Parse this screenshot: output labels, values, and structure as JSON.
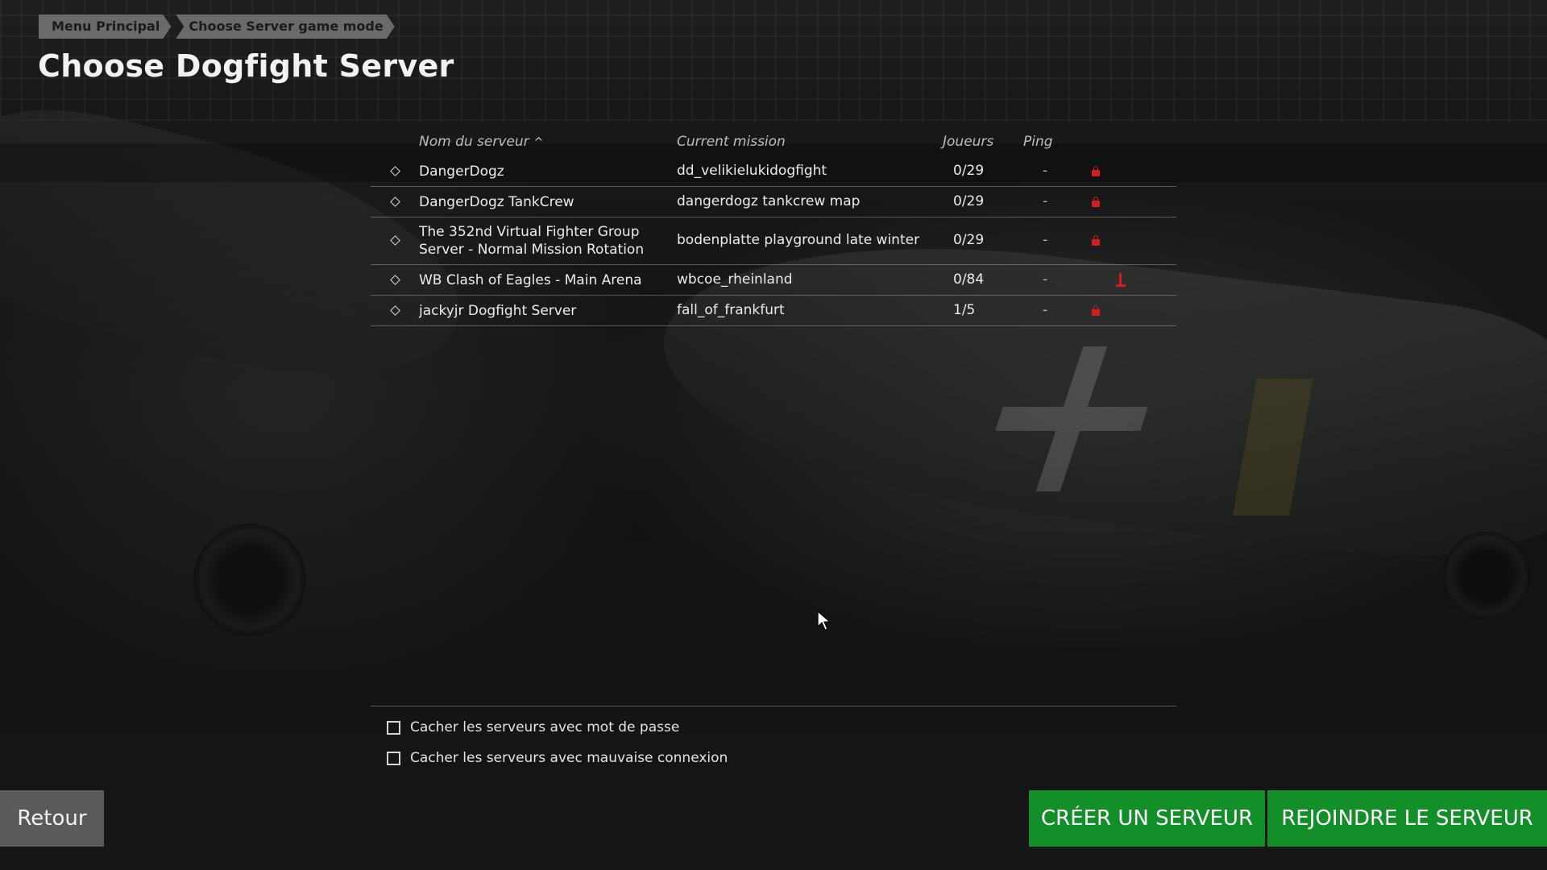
{
  "breadcrumb": {
    "items": [
      "Menu Principal",
      "Choose Server game mode"
    ]
  },
  "page_title": "Choose Dogfight Server",
  "table": {
    "headers": {
      "name": "Nom du serveur",
      "mission": "Current mission",
      "players": "Joueurs",
      "ping": "Ping"
    },
    "sort": {
      "column": "name",
      "direction": "ascending",
      "icon": "chevron-up-icon"
    },
    "rows": [
      {
        "name": "DangerDogz",
        "mission": "dd_velikielukidogfight",
        "players": "0/29",
        "ping": "-",
        "status_icon": "lock-icon"
      },
      {
        "name": "DangerDogz TankCrew",
        "mission": "dangerdogz tankcrew map",
        "players": "0/29",
        "ping": "-",
        "status_icon": "lock-icon"
      },
      {
        "name": "The 352nd Virtual Fighter Group Server - Normal Mission Rotation",
        "mission": "bodenplatte playground late winter",
        "players": "0/29",
        "ping": "-",
        "status_icon": "lock-icon"
      },
      {
        "name": "WB Clash of Eagles - Main Arena",
        "mission": "wbcoe_rheinland",
        "players": "0/84",
        "ping": "-",
        "status_icon": "flag-icon"
      },
      {
        "name": "jackyjr Dogfight Server",
        "mission": "fall_of_frankfurt",
        "players": "1/5",
        "ping": "-",
        "status_icon": "lock-icon"
      }
    ]
  },
  "filters": {
    "hide_password": {
      "label": "Cacher les serveurs avec mot de passe",
      "checked": false
    },
    "hide_bad_connection": {
      "label": "Cacher les serveurs avec mauvaise connexion",
      "checked": false
    }
  },
  "buttons": {
    "back": "Retour",
    "create": "CRÉER UN SERVEUR",
    "join": "REJOINDRE LE SERVEUR"
  },
  "colors": {
    "accent_green": "#138f2a",
    "lock_red": "#d31d1d",
    "back_button": "#5a5a5a"
  }
}
